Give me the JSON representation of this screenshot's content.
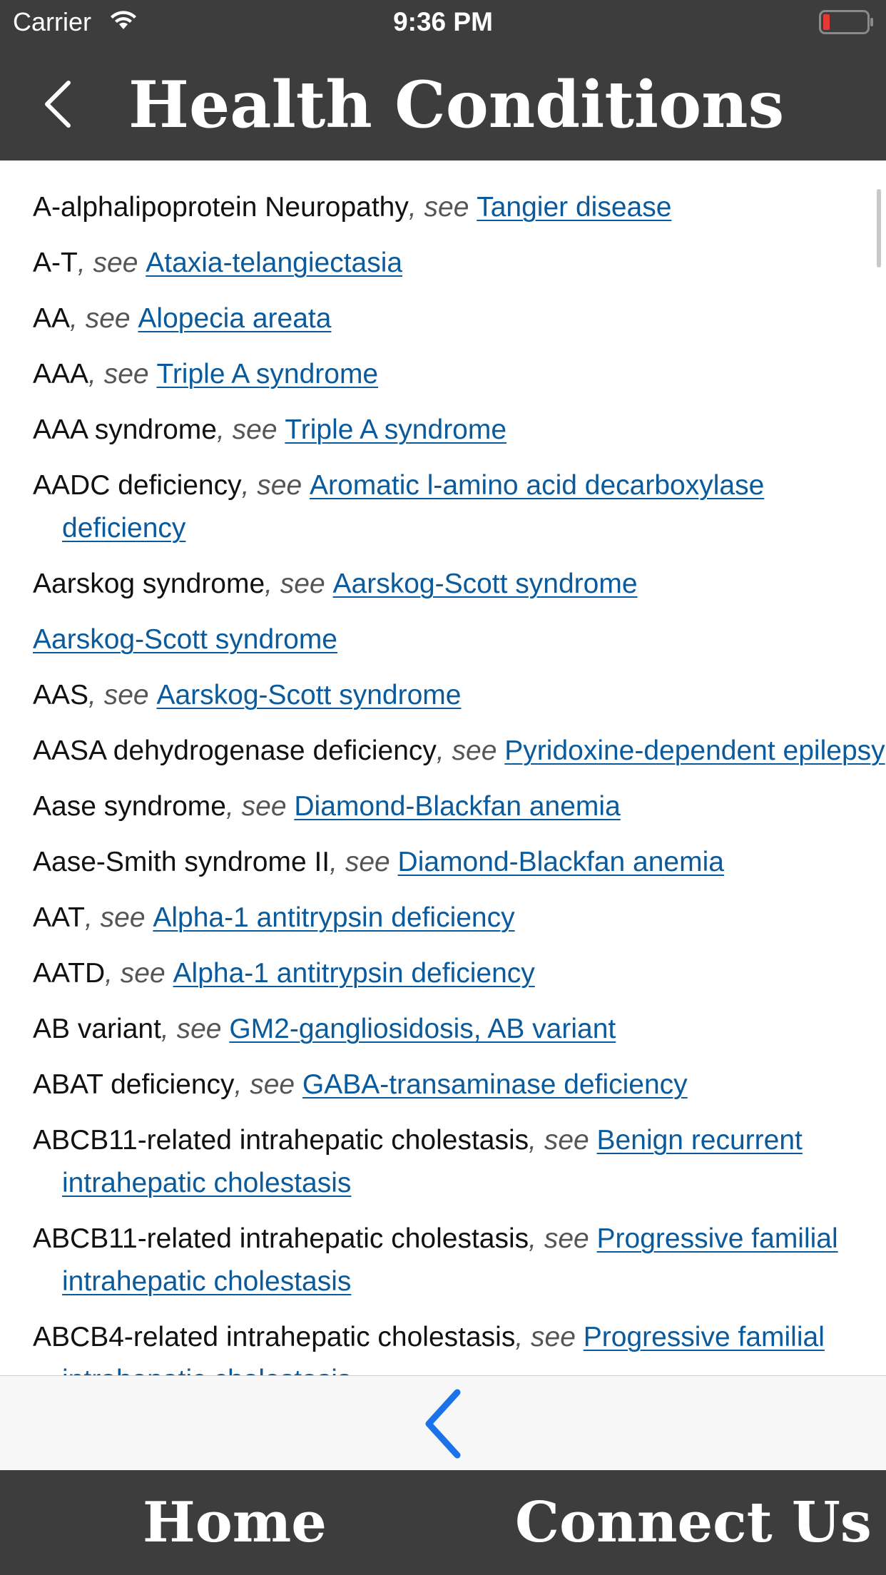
{
  "status_bar": {
    "carrier": "Carrier",
    "time": "9:36 PM",
    "wifi_icon": "wifi-icon",
    "battery_icon": "battery-low-icon",
    "battery_color": "#e53935"
  },
  "nav": {
    "title": "Health Conditions",
    "back_icon": "chevron-left-icon"
  },
  "colors": {
    "bar_background": "#3d3d3d",
    "link": "#0a5a9c",
    "toolbar_accent": "#1a73e8"
  },
  "entries": [
    {
      "term": "A-alphalipoprotein Neuropathy",
      "see": ", see ",
      "link": "Tangier disease"
    },
    {
      "term": "A-T",
      "see": ", see ",
      "link": "Ataxia-telangiectasia"
    },
    {
      "term": "AA",
      "see": ", see ",
      "link": "Alopecia areata"
    },
    {
      "term": "AAA",
      "see": ", see ",
      "link": "Triple A syndrome"
    },
    {
      "term": "AAA syndrome",
      "see": ", see ",
      "link": "Triple A syndrome"
    },
    {
      "term": "AADC deficiency",
      "see": ", see ",
      "link": "Aromatic l-amino acid decarboxylase deficiency"
    },
    {
      "term": "Aarskog syndrome",
      "see": ", see ",
      "link": "Aarskog-Scott syndrome"
    },
    {
      "term": "",
      "see": "",
      "link": "Aarskog-Scott syndrome"
    },
    {
      "term": "AAS",
      "see": ", see ",
      "link": "Aarskog-Scott syndrome"
    },
    {
      "term": "AASA dehydrogenase deficiency",
      "see": ", see ",
      "link": "Pyridoxine-dependent epilepsy"
    },
    {
      "term": "Aase syndrome",
      "see": ", see ",
      "link": "Diamond-Blackfan anemia"
    },
    {
      "term": "Aase-Smith syndrome II",
      "see": ", see ",
      "link": "Diamond-Blackfan anemia"
    },
    {
      "term": "AAT",
      "see": ", see ",
      "link": "Alpha-1 antitrypsin deficiency"
    },
    {
      "term": "AATD",
      "see": ", see ",
      "link": "Alpha-1 antitrypsin deficiency"
    },
    {
      "term": "AB variant",
      "see": ", see ",
      "link": "GM2-gangliosidosis, AB variant"
    },
    {
      "term": "ABAT deficiency",
      "see": ", see ",
      "link": "GABA-transaminase deficiency"
    },
    {
      "term": "ABCB11-related intrahepatic cholestasis",
      "see": ", see ",
      "link": "Benign recurrent intrahepatic cholestasis"
    },
    {
      "term": "ABCB11-related intrahepatic cholestasis",
      "see": ", see ",
      "link": "Progressive familial intrahepatic cholestasis"
    },
    {
      "term": "ABCB4-related intrahepatic cholestasis",
      "see": ", see ",
      "link": "Progressive familial intrahepatic cholestasis"
    }
  ],
  "toolbar": {
    "back_icon": "chevron-left-icon"
  },
  "tabs": {
    "home": "Home",
    "connect": "Connect Us"
  }
}
